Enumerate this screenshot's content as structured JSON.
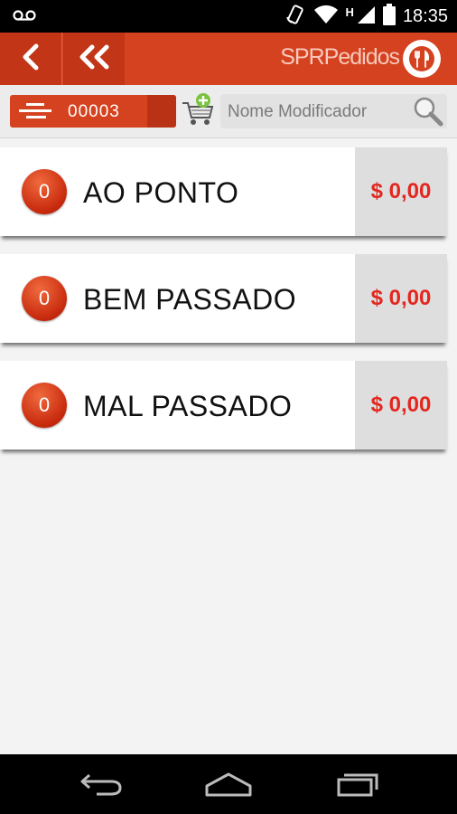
{
  "status_bar": {
    "time": "18:35",
    "icons": [
      "voicemail-icon",
      "rotation-icon",
      "wifi-icon",
      "signal-icon",
      "battery-icon"
    ],
    "network_letter": "H"
  },
  "app_bar": {
    "title": "SPRPedidos",
    "back_icon": "chevron-left-icon",
    "back_all_icon": "double-chevron-left-icon",
    "logo_icon": "fork-knife-icon"
  },
  "toolbar": {
    "order_number": "00003",
    "search_placeholder": "Nome Modificador",
    "cart_icon": "cart-add-icon",
    "search_icon": "magnifier-icon"
  },
  "modifiers": [
    {
      "count": "0",
      "name": "AO PONTO",
      "price": "$ 0,00"
    },
    {
      "count": "0",
      "name": "BEM PASSADO",
      "price": "$ 0,00"
    },
    {
      "count": "0",
      "name": "MAL PASSADO",
      "price": "$ 0,00"
    }
  ],
  "nav_bar": {
    "icons": [
      "back-icon",
      "home-icon",
      "recents-icon"
    ]
  },
  "colors": {
    "accent": "#d5421f",
    "price": "#e3271f",
    "badge": "#c7290c"
  }
}
